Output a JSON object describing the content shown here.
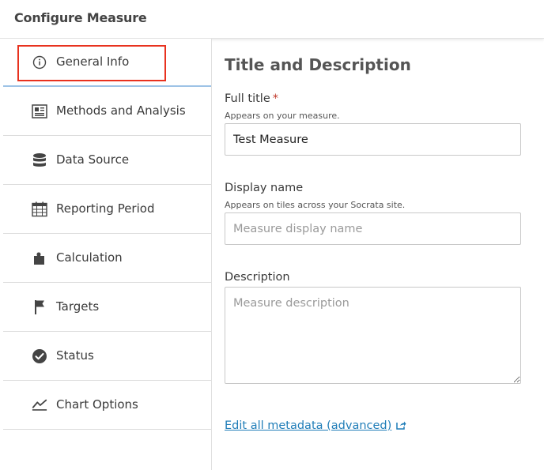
{
  "header": {
    "title": "Configure Measure"
  },
  "sidebar": {
    "items": [
      {
        "label": "General Info",
        "icon": "info-circle-icon",
        "active": true
      },
      {
        "label": "Methods and Analysis",
        "icon": "document-icon"
      },
      {
        "label": "Data Source",
        "icon": "database-icon"
      },
      {
        "label": "Reporting Period",
        "icon": "calendar-icon"
      },
      {
        "label": "Calculation",
        "icon": "puzzle-icon"
      },
      {
        "label": "Targets",
        "icon": "flag-icon"
      },
      {
        "label": "Status",
        "icon": "check-circle-icon"
      },
      {
        "label": "Chart Options",
        "icon": "line-chart-icon"
      }
    ]
  },
  "main": {
    "section_title": "Title and Description",
    "full_title": {
      "label": "Full title",
      "required_marker": "*",
      "help": "Appears on your measure.",
      "value": "Test Measure"
    },
    "display_name": {
      "label": "Display name",
      "help": "Appears on tiles across your Socrata site.",
      "value": "",
      "placeholder": "Measure display name"
    },
    "description": {
      "label": "Description",
      "value": "",
      "placeholder": "Measure description"
    },
    "metadata_link": "Edit all metadata (advanced)"
  },
  "colors": {
    "active_accent": "#2f8fd6",
    "highlight_box": "#e8321f",
    "link": "#1f7db8",
    "required": "#c0392b"
  }
}
